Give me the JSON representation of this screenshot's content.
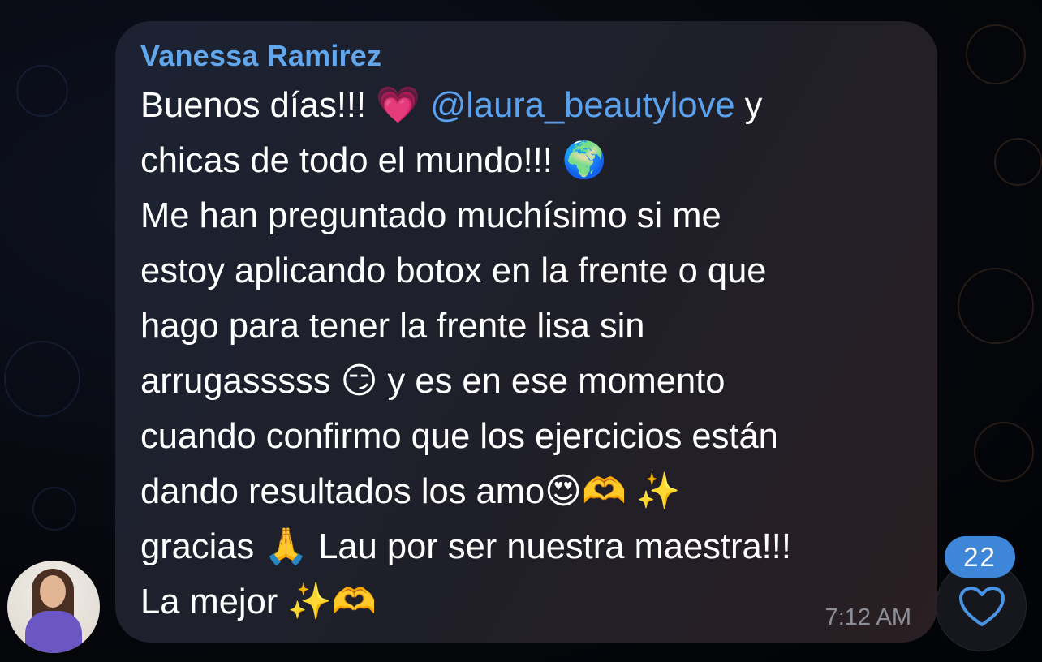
{
  "message": {
    "sender": "Vanessa Ramirez",
    "lines": [
      {
        "parts": [
          {
            "t": "Buenos días!!! "
          },
          {
            "e": "💗"
          },
          {
            "t": " "
          },
          {
            "m": "@laura_beautylove"
          },
          {
            "t": " y"
          }
        ]
      },
      {
        "parts": [
          {
            "t": "chicas de todo el mundo!!! "
          },
          {
            "e": "🌍"
          }
        ]
      },
      {
        "parts": [
          {
            "t": "Me han preguntado muchísimo si me"
          }
        ]
      },
      {
        "parts": [
          {
            "t": "estoy aplicando botox en la frente o que"
          }
        ]
      },
      {
        "parts": [
          {
            "t": "hago para tener la frente lisa sin"
          }
        ]
      },
      {
        "parts": [
          {
            "t": "arrugasssss "
          },
          {
            "e": "😏"
          },
          {
            "t": " y es en ese momento"
          }
        ]
      },
      {
        "parts": [
          {
            "t": "cuando confirmo que los ejercicios están"
          }
        ]
      },
      {
        "parts": [
          {
            "t": "dando resultados los amo"
          },
          {
            "e": "😍"
          },
          {
            "e": "🫶"
          },
          {
            "t": " "
          },
          {
            "e": "✨"
          }
        ]
      },
      {
        "parts": [
          {
            "t": "gracias "
          },
          {
            "e": "🙏"
          },
          {
            "t": " Lau por ser nuestra maestra!!!"
          }
        ]
      },
      {
        "parts": [
          {
            "t": "La mejor "
          },
          {
            "e": "✨"
          },
          {
            "e": "🫶"
          }
        ]
      }
    ],
    "time": "7:12 AM"
  },
  "reaction": {
    "count": "22",
    "icon": "heart-icon"
  },
  "avatar": {
    "icon": "user-avatar"
  },
  "colors": {
    "sender": "#62a7ec",
    "mention": "#5aa2ef",
    "badge": "#3d86d8",
    "text": "#ffffff",
    "time": "#8d8f99"
  }
}
